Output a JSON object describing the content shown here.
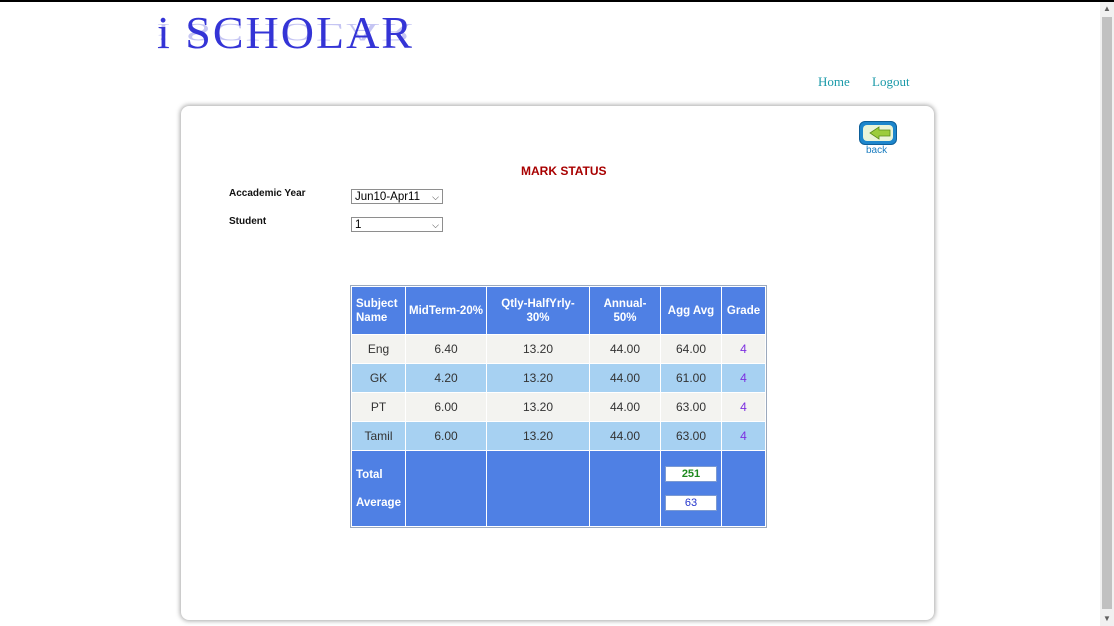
{
  "brand": {
    "logo_text": "i SCHOLAR"
  },
  "nav": {
    "home": "Home",
    "logout": "Logout"
  },
  "panel": {
    "back_label": "back",
    "title": "MARK STATUS",
    "year_label": "Accademic Year",
    "year_value": "Jun10-Apr11",
    "student_label": "Student",
    "student_value": "1"
  },
  "table": {
    "headers": [
      "Subject Name",
      "MidTerm-20%",
      "Qtly-HalfYrly-30%",
      "Annual-50%",
      "Agg Avg",
      "Grade"
    ],
    "rows": [
      [
        "Eng",
        "6.40",
        "13.20",
        "44.00",
        "64.00",
        "4"
      ],
      [
        "GK",
        "4.20",
        "13.20",
        "44.00",
        "61.00",
        "4"
      ],
      [
        "PT",
        "6.00",
        "13.20",
        "44.00",
        "63.00",
        "4"
      ],
      [
        "Tamil",
        "6.00",
        "13.20",
        "44.00",
        "63.00",
        "4"
      ]
    ],
    "total_label": "Total",
    "average_label": "Average",
    "total_value": "251",
    "average_value": "63"
  },
  "colors": {
    "header_blue": "#4f80e4",
    "row_blue": "#a7d1f2",
    "title_red": "#a80000",
    "nav_teal": "#1b9aa9"
  }
}
